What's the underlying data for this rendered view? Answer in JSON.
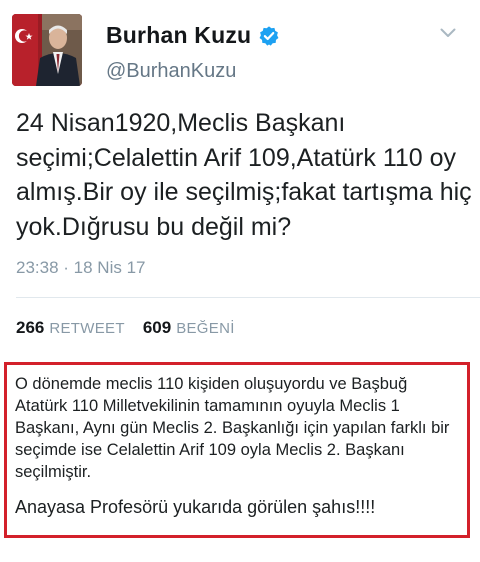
{
  "tweet": {
    "author_name": "Burhan Kuzu",
    "handle": "@BurhanKuzu",
    "verified": true,
    "text": "24 Nisan1920,Meclis Başkanı seçimi;Celalettin Arif 109,Atatürk 110 oy almış.Bir oy ile seçilmiş;fakat tartışma hiç yok.Dığrusu bu değil mi?",
    "time": "23:38",
    "date": "18 Nis 17",
    "retweet_count": "266",
    "retweet_label": "RETWEET",
    "like_count": "609",
    "like_label": "BEĞENİ"
  },
  "annotation": {
    "body": "O dönemde meclis 110 kişiden oluşuyordu ve Başbuğ Atatürk 110 Milletvekilinin tamamının oyuyla Meclis 1 Başkanı, Aynı gün Meclis 2. Başkanlığı için yapılan farklı bir seçimde ise Celalettin Arif 109 oyla Meclis 2. Başkanı seçilmiştir.",
    "footer": "Anayasa Profesörü yukarıda görülen şahıs!!!!"
  },
  "icons": {
    "avatar": "profile-photo",
    "verified": "verified-badge-icon",
    "menu": "chevron-down-icon"
  },
  "colors": {
    "verified_blue": "#1da1f2",
    "annotation_border": "#d3202a",
    "muted_text": "#8899a6"
  }
}
